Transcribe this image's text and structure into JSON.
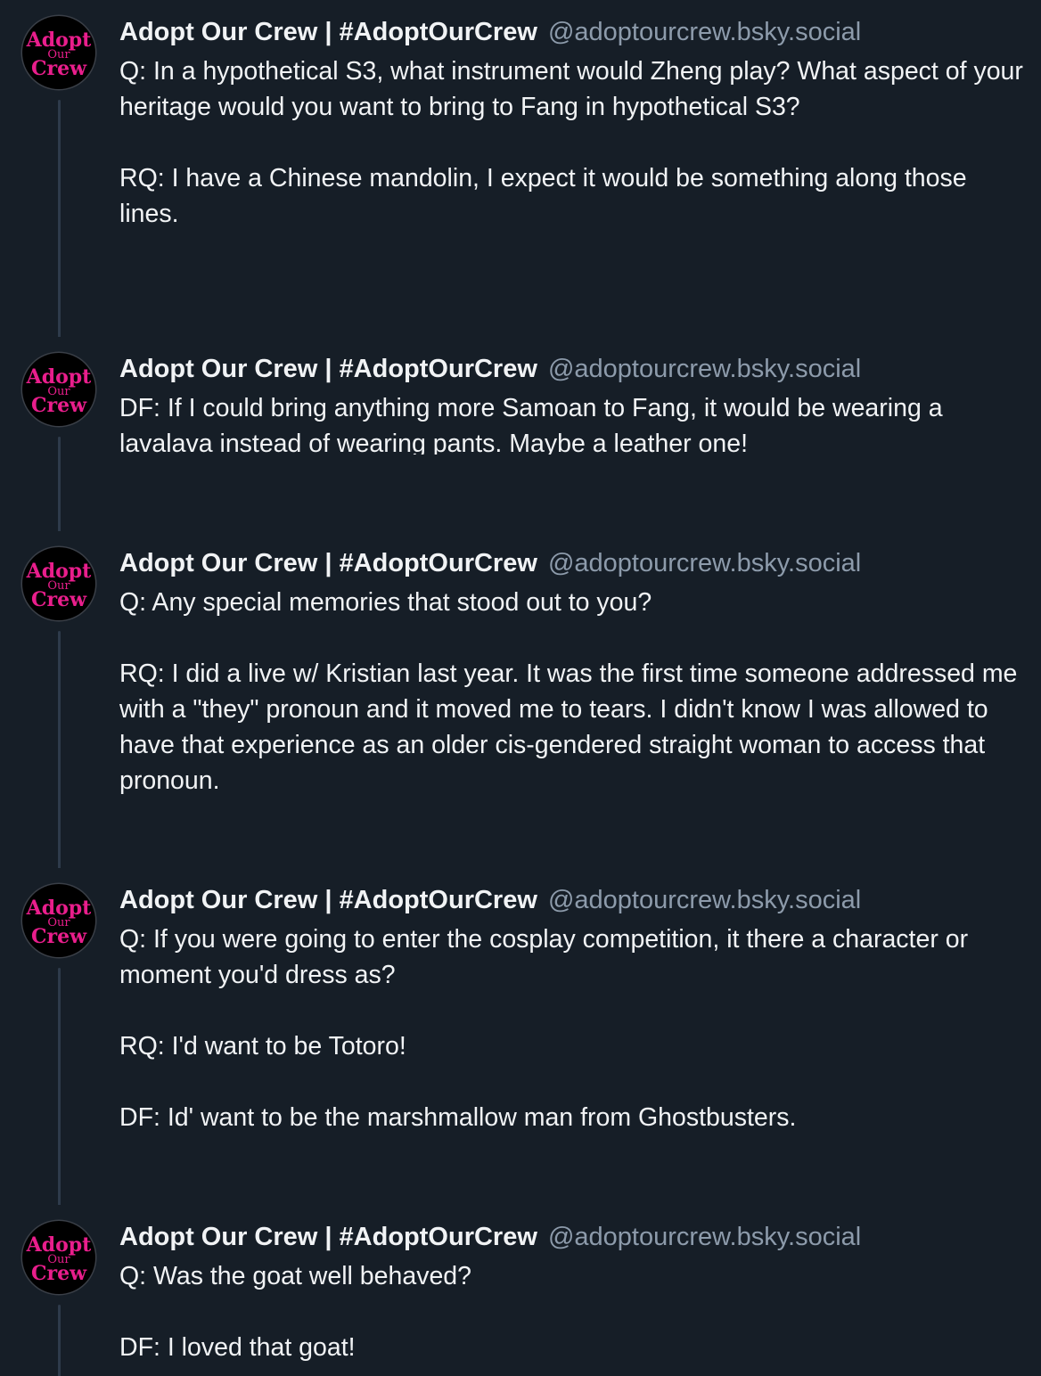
{
  "accent_color": "#e91e8c",
  "background_color": "#161e27",
  "posts": [
    {
      "author": "Adopt Our Crew | #AdoptOurCrew",
      "handle": "@adoptourcrew.bsky.social",
      "avatar_text": {
        "line1": "Adopt",
        "line2": "Our",
        "line3": "Crew"
      },
      "paragraphs": [
        "Q: In a hypothetical S3, what instrument would Zheng play? What aspect of your heritage would you want to bring to Fang in hypothetical S3?",
        "RQ: I have a Chinese mandolin, I expect it would be something along those lines."
      ]
    },
    {
      "author": "Adopt Our Crew | #AdoptOurCrew",
      "handle": "@adoptourcrew.bsky.social",
      "avatar_text": {
        "line1": "Adopt",
        "line2": "Our",
        "line3": "Crew"
      },
      "paragraphs": [
        "DF: If I could bring anything more Samoan to Fang, it would be wearing a lavalava instead of wearing pants. Maybe a leather one!"
      ]
    },
    {
      "author": "Adopt Our Crew | #AdoptOurCrew",
      "handle": "@adoptourcrew.bsky.social",
      "avatar_text": {
        "line1": "Adopt",
        "line2": "Our",
        "line3": "Crew"
      },
      "paragraphs": [
        "Q: Any special memories that stood out to you?",
        "RQ: I did a live w/ Kristian last year. It was the first time someone addressed me with a \"they\" pronoun and it moved me to tears. I didn't know I was allowed to have that experience as an older cis-gendered straight woman to access that pronoun."
      ]
    },
    {
      "author": "Adopt Our Crew | #AdoptOurCrew",
      "handle": "@adoptourcrew.bsky.social",
      "avatar_text": {
        "line1": "Adopt",
        "line2": "Our",
        "line3": "Crew"
      },
      "paragraphs": [
        "Q: If you were going to enter the cosplay competition, it there a character or moment you'd dress as?",
        "RQ: I'd want to be Totoro!",
        "DF: Id' want to be the marshmallow man from Ghostbusters."
      ]
    },
    {
      "author": "Adopt Our Crew | #AdoptOurCrew",
      "handle": "@adoptourcrew.bsky.social",
      "avatar_text": {
        "line1": "Adopt",
        "line2": "Our",
        "line3": "Crew"
      },
      "paragraphs": [
        "Q: Was the goat well behaved?",
        "DF: I loved that goat!"
      ]
    }
  ]
}
